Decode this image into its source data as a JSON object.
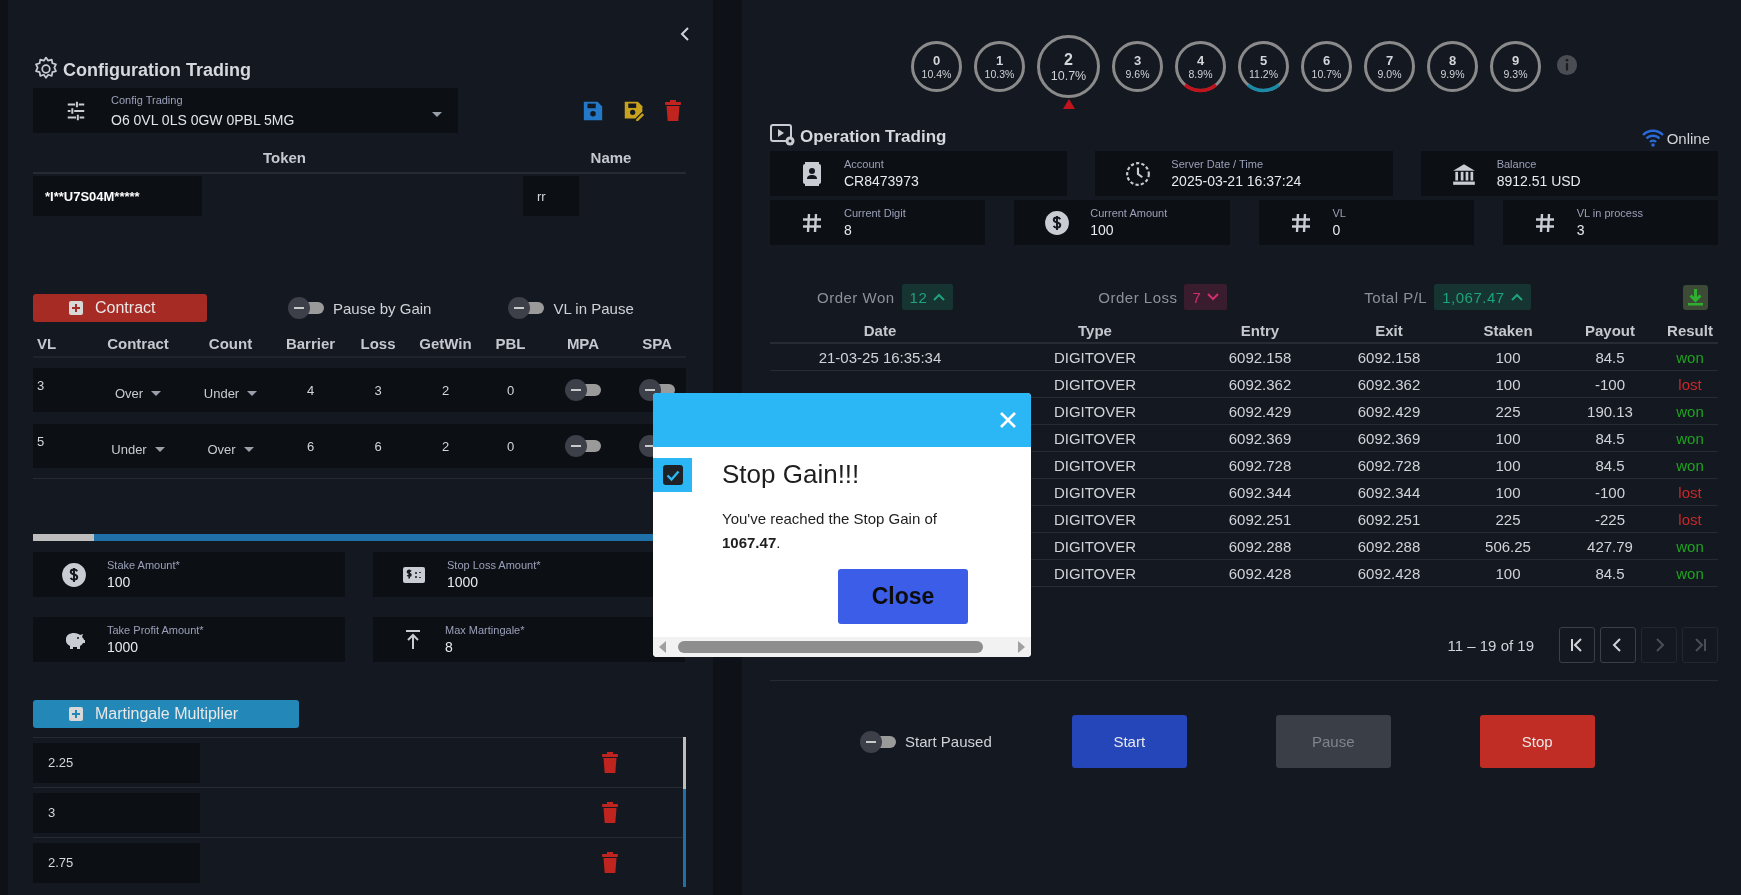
{
  "config_panel": {
    "title": "Configuration Trading",
    "config_select": {
      "label": "Config Trading",
      "value": "O6 0VL 0LS 0GW 0PBL 5MG"
    },
    "token_table": {
      "columns": [
        "Token",
        "Name"
      ],
      "token": "*I**U7S04M*****",
      "name": "rr"
    },
    "contract_button": "Contract",
    "toggles": [
      {
        "label": "Pause by Gain",
        "on": false
      },
      {
        "label": "VL in Pause",
        "on": false
      }
    ],
    "contracts": {
      "columns": [
        "VL",
        "Contract",
        "Count",
        "Barrier",
        "Loss",
        "GetWin",
        "PBL",
        "MPA",
        "SPA"
      ],
      "rows": [
        {
          "vl": "3",
          "contract": "Over",
          "count": "Under",
          "barrier": "4",
          "loss": "3",
          "getwin": "2",
          "pbl": "0",
          "mpa": false,
          "spa": false
        },
        {
          "vl": "5",
          "contract": "Under",
          "count": "Over",
          "barrier": "6",
          "loss": "6",
          "getwin": "2",
          "pbl": "0",
          "mpa": false,
          "spa": false
        }
      ]
    },
    "fields": [
      {
        "kind": "dollar",
        "label": "Stake Amount*",
        "value": "100"
      },
      {
        "kind": "stoploss",
        "label": "Stop Loss Amount*",
        "value": "1000"
      },
      {
        "kind": "piggy",
        "label": "Take Profit Amount*",
        "value": "1000"
      },
      {
        "kind": "max",
        "label": "Max Martingale*",
        "value": "8"
      }
    ],
    "martingale_button": "Martingale Multiplier",
    "multipliers": [
      "2.25",
      "3",
      "2.75"
    ]
  },
  "digits": [
    {
      "digit": "0",
      "percent": "10.4%",
      "selected": false
    },
    {
      "digit": "1",
      "percent": "10.3%",
      "selected": false
    },
    {
      "digit": "2",
      "percent": "10.7%",
      "selected": true
    },
    {
      "digit": "3",
      "percent": "9.6%",
      "selected": false
    },
    {
      "digit": "4",
      "percent": "8.9%",
      "selected": false,
      "color": "#c0141c"
    },
    {
      "digit": "5",
      "percent": "11.2%",
      "selected": false,
      "color": "#1a8aa6"
    },
    {
      "digit": "6",
      "percent": "10.7%",
      "selected": false
    },
    {
      "digit": "7",
      "percent": "9.0%",
      "selected": false
    },
    {
      "digit": "8",
      "percent": "9.9%",
      "selected": false
    },
    {
      "digit": "9",
      "percent": "9.3%",
      "selected": false
    }
  ],
  "operation": {
    "title": "Operation Trading",
    "status": "Online",
    "cards": [
      {
        "kind": "contact",
        "label": "Account",
        "value": "CR8473973"
      },
      {
        "kind": "clock",
        "label": "Server Date / Time",
        "value": "2025-03-21 16:37:24"
      },
      {
        "kind": "bank",
        "label": "Balance",
        "value": "8912.51 USD"
      }
    ],
    "cards_2": [
      {
        "kind": "hash",
        "label": "Current Digit",
        "value": "8"
      },
      {
        "kind": "dollar",
        "label": "Current Amount",
        "value": "100"
      },
      {
        "kind": "hash",
        "label": "VL",
        "value": "0"
      },
      {
        "kind": "hash",
        "label": "VL in process",
        "value": "3"
      }
    ],
    "summary": [
      {
        "label": "Order Won",
        "value": "12",
        "kind": "up",
        "color": "#1fa37a"
      },
      {
        "label": "Order Loss",
        "value": "7",
        "kind": "down",
        "color": "#d0306a"
      },
      {
        "label": "Total P/L",
        "value": "1,067.47",
        "kind": "up",
        "color": "#1fa37a"
      }
    ],
    "table": {
      "columns": [
        "Date",
        "Type",
        "Entry",
        "Exit",
        "Staken",
        "Payout",
        "Result"
      ],
      "rows": [
        {
          "date": "21-03-25 16:35:34",
          "type": "DIGITOVER",
          "entry": "6092.158",
          "exit": "6092.158",
          "staken": "100",
          "payout": "84.5",
          "result": "won",
          "color": "#1fa31f"
        },
        {
          "type": "DIGITOVER",
          "entry": "6092.362",
          "exit": "6092.362",
          "staken": "100",
          "payout": "-100",
          "result": "lost",
          "color": "#c8282a"
        },
        {
          "type": "DIGITOVER",
          "entry": "6092.429",
          "exit": "6092.429",
          "staken": "225",
          "payout": "190.13",
          "result": "won",
          "color": "#1fa31f"
        },
        {
          "type": "DIGITOVER",
          "entry": "6092.369",
          "exit": "6092.369",
          "staken": "100",
          "payout": "84.5",
          "result": "won",
          "color": "#1fa31f"
        },
        {
          "type": "DIGITOVER",
          "entry": "6092.728",
          "exit": "6092.728",
          "staken": "100",
          "payout": "84.5",
          "result": "won",
          "color": "#1fa31f"
        },
        {
          "type": "DIGITOVER",
          "entry": "6092.344",
          "exit": "6092.344",
          "staken": "100",
          "payout": "-100",
          "result": "lost",
          "color": "#c8282a"
        },
        {
          "type": "DIGITOVER",
          "entry": "6092.251",
          "exit": "6092.251",
          "staken": "225",
          "payout": "-225",
          "result": "lost",
          "color": "#c8282a"
        },
        {
          "type": "DIGITOVER",
          "entry": "6092.288",
          "exit": "6092.288",
          "staken": "506.25",
          "payout": "427.79",
          "result": "won",
          "color": "#1fa31f"
        },
        {
          "type": "DIGITOVER",
          "entry": "6092.428",
          "exit": "6092.428",
          "staken": "100",
          "payout": "84.5",
          "result": "won",
          "color": "#1fa31f"
        }
      ]
    },
    "pagination": {
      "range": "11 – 19 of 19",
      "buttons": [
        {
          "kind": "first",
          "disabled": false
        },
        {
          "kind": "prev",
          "disabled": false
        },
        {
          "kind": "next",
          "disabled": true
        },
        {
          "kind": "last",
          "disabled": true
        }
      ]
    },
    "start_paused": {
      "label": "Start Paused",
      "on": false
    },
    "buttons": [
      {
        "kind": "start",
        "label": "Start",
        "disabled": false
      },
      {
        "kind": "pause",
        "label": "Pause",
        "disabled": true
      },
      {
        "kind": "stop",
        "label": "Stop",
        "disabled": false
      }
    ]
  },
  "dialog": {
    "title": "Stop Gain!!!",
    "message": "You've reached the Stop Gain of **1067.47**.",
    "checked": true,
    "button": "Close"
  }
}
